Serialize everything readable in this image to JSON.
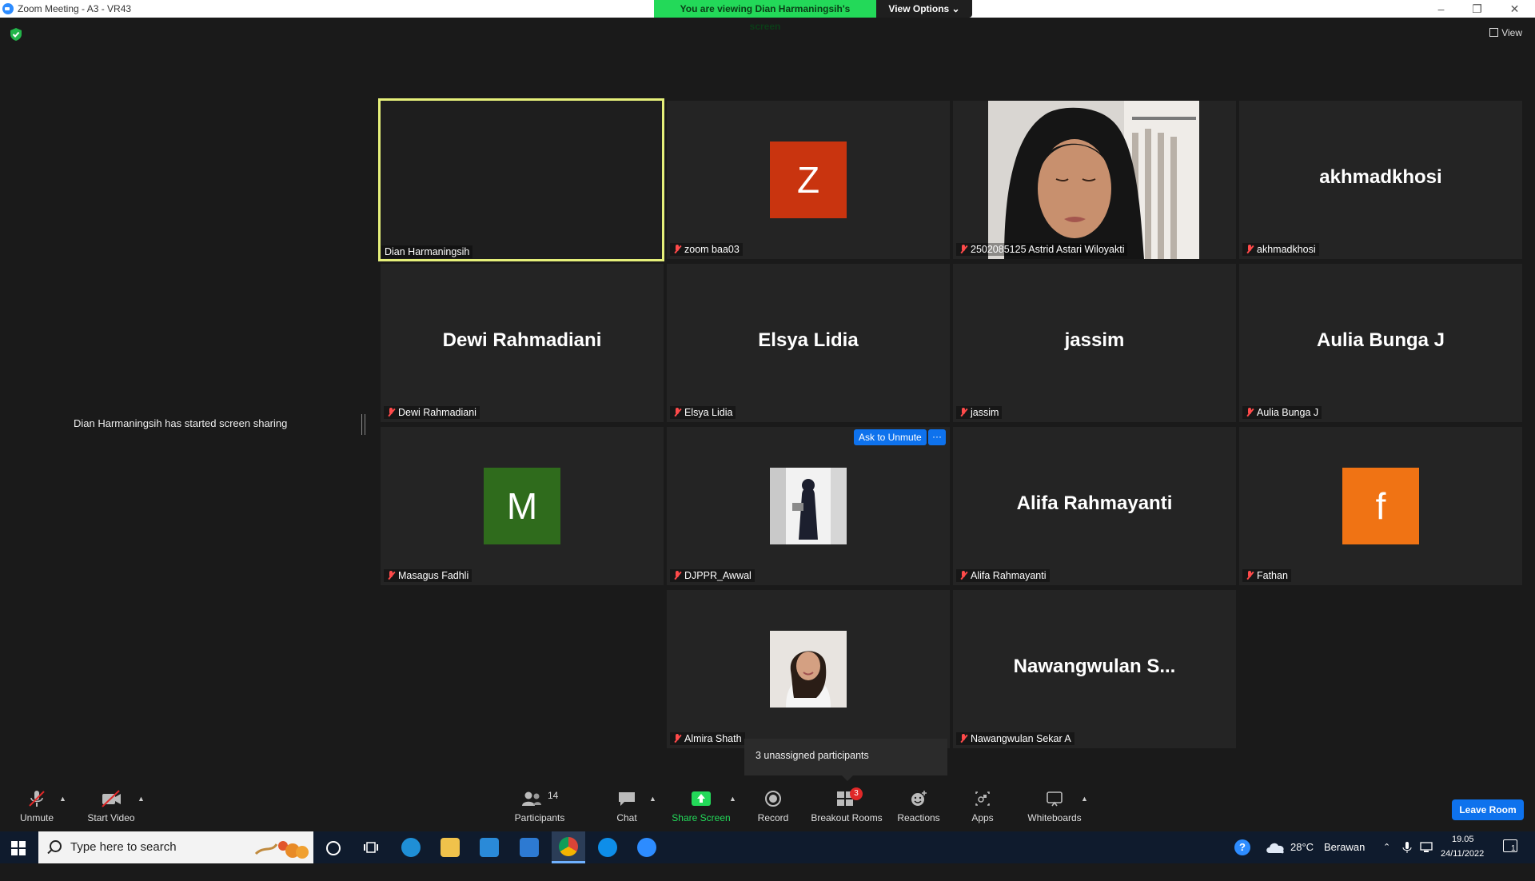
{
  "window": {
    "title": "Zoom Meeting - A3 - VR43",
    "minimize": "–",
    "restore": "❐",
    "close": "✕"
  },
  "share_banner": {
    "message": "You are viewing Dian Harmaningsih's screen",
    "view_options": "View Options ⌄"
  },
  "view_button": "View",
  "notice": "Dian Harmaningsih has started screen sharing",
  "tiles": [
    {
      "label": "Dian Harmaningsih",
      "display": "",
      "muted": false
    },
    {
      "label": "zoom baa03",
      "display": "Z",
      "muted": true
    },
    {
      "label": "2502085125 Astrid Astari Wiloyakti",
      "display": "",
      "muted": true
    },
    {
      "label": "akhmadkhosi",
      "display": "akhmadkhosi",
      "muted": true
    },
    {
      "label": "Dewi Rahmadiani",
      "display": "Dewi Rahmadiani",
      "muted": true
    },
    {
      "label": "Elsya Lidia",
      "display": "Elsya Lidia",
      "muted": true
    },
    {
      "label": "jassim",
      "display": "jassim",
      "muted": true
    },
    {
      "label": "Aulia Bunga J",
      "display": "Aulia Bunga J",
      "muted": true
    },
    {
      "label": "Masagus Fadhli",
      "display": "M",
      "muted": true
    },
    {
      "label": "DJPPR_Awwal",
      "display": "",
      "muted": true
    },
    {
      "label": "Alifa Rahmayanti",
      "display": "Alifa Rahmayanti",
      "muted": true
    },
    {
      "label": "Fathan",
      "display": "f",
      "muted": true
    },
    {
      "label": "Almira Shath",
      "display": "",
      "muted": true
    },
    {
      "label": "Nawangwulan Sekar A",
      "display": "Nawangwulan  S...",
      "muted": true
    }
  ],
  "ask_to_unmute": "Ask to Unmute",
  "more": "···",
  "tooltip": "3 unassigned participants",
  "toolbar": {
    "unmute": "Unmute",
    "start_video": "Start Video",
    "participants": "Participants",
    "participants_count": "14",
    "chat": "Chat",
    "share_screen": "Share Screen",
    "record": "Record",
    "breakout_rooms": "Breakout Rooms",
    "breakout_badge": "3",
    "reactions": "Reactions",
    "apps": "Apps",
    "whiteboards": "Whiteboards",
    "leave": "Leave Room"
  },
  "taskbar": {
    "search_placeholder": "Type here to search",
    "weather_temp": "28°C",
    "weather_desc": "Berawan",
    "time": "19.05",
    "date": "24/11/2022",
    "notification_count": "1"
  },
  "colors": {
    "active_border": "#e6f07a",
    "avatar_z": "#c9340f",
    "avatar_m": "#2f6b1c",
    "avatar_f": "#f07314",
    "share_green": "#23d959",
    "zoom_blue": "#0e72ed"
  },
  "icons": [
    "zoom-app-icon",
    "shield-icon",
    "grid-view-icon",
    "mic-off-icon",
    "video-off-icon",
    "participants-icon",
    "chat-icon",
    "share-screen-icon",
    "record-icon",
    "breakout-rooms-icon",
    "reactions-icon",
    "apps-icon",
    "whiteboard-icon",
    "windows-start-icon",
    "search-icon",
    "cortana-icon",
    "task-view-icon",
    "edge-icon",
    "file-explorer-icon",
    "store-icon",
    "mail-icon",
    "chrome-icon",
    "teamviewer-icon",
    "zoom-taskbar-icon",
    "help-icon",
    "cloud-icon",
    "tray-chevron-icon",
    "microphone-tray-icon",
    "network-icon",
    "notification-icon"
  ]
}
